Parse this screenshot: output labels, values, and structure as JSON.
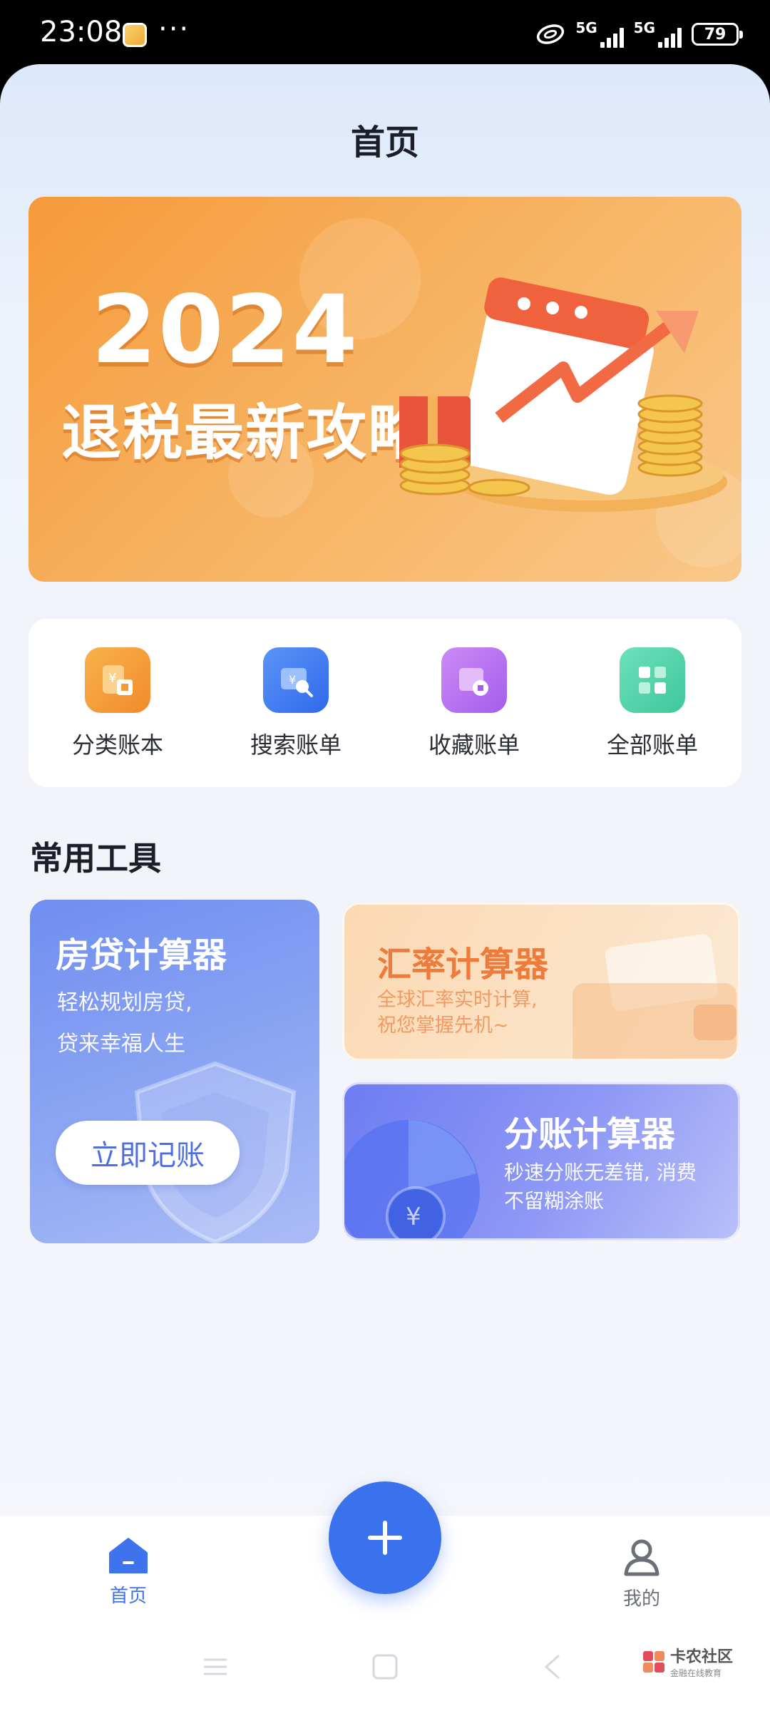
{
  "status_bar": {
    "time": "23:08",
    "dots": "···",
    "network_1": "5G",
    "network_2": "5G",
    "battery": "79"
  },
  "header": {
    "title": "首页"
  },
  "banner": {
    "year": "2024",
    "subtitle": "退税最新攻略"
  },
  "quick_entries": [
    {
      "label": "分类账本",
      "icon": "ledger-icon",
      "color": "#f39a3a"
    },
    {
      "label": "搜索账单",
      "icon": "search-bill-icon",
      "color": "#3f7bf0"
    },
    {
      "label": "收藏账单",
      "icon": "favorite-bill-icon",
      "color": "#b46ff0"
    },
    {
      "label": "全部账单",
      "icon": "all-bills-icon",
      "color": "#4fd1a8"
    }
  ],
  "tools": {
    "section_title": "常用工具",
    "mortgage": {
      "title": "房贷计算器",
      "desc_line1": "轻松规划房贷,",
      "desc_line2": "贷来幸福人生",
      "button": "立即记账"
    },
    "fx": {
      "title": "汇率计算器",
      "desc_line1": "全球汇率实时计算,",
      "desc_line2": "祝您掌握先机~"
    },
    "split": {
      "title": "分账计算器",
      "desc_line1": "秒速分账无差错, 消费",
      "desc_line2": "不留糊涂账"
    }
  },
  "tab_bar": {
    "home": "首页",
    "mine": "我的",
    "active_color": "#3f73ed"
  },
  "watermark": {
    "main": "卡农社区",
    "sub": "金融在线教育"
  }
}
